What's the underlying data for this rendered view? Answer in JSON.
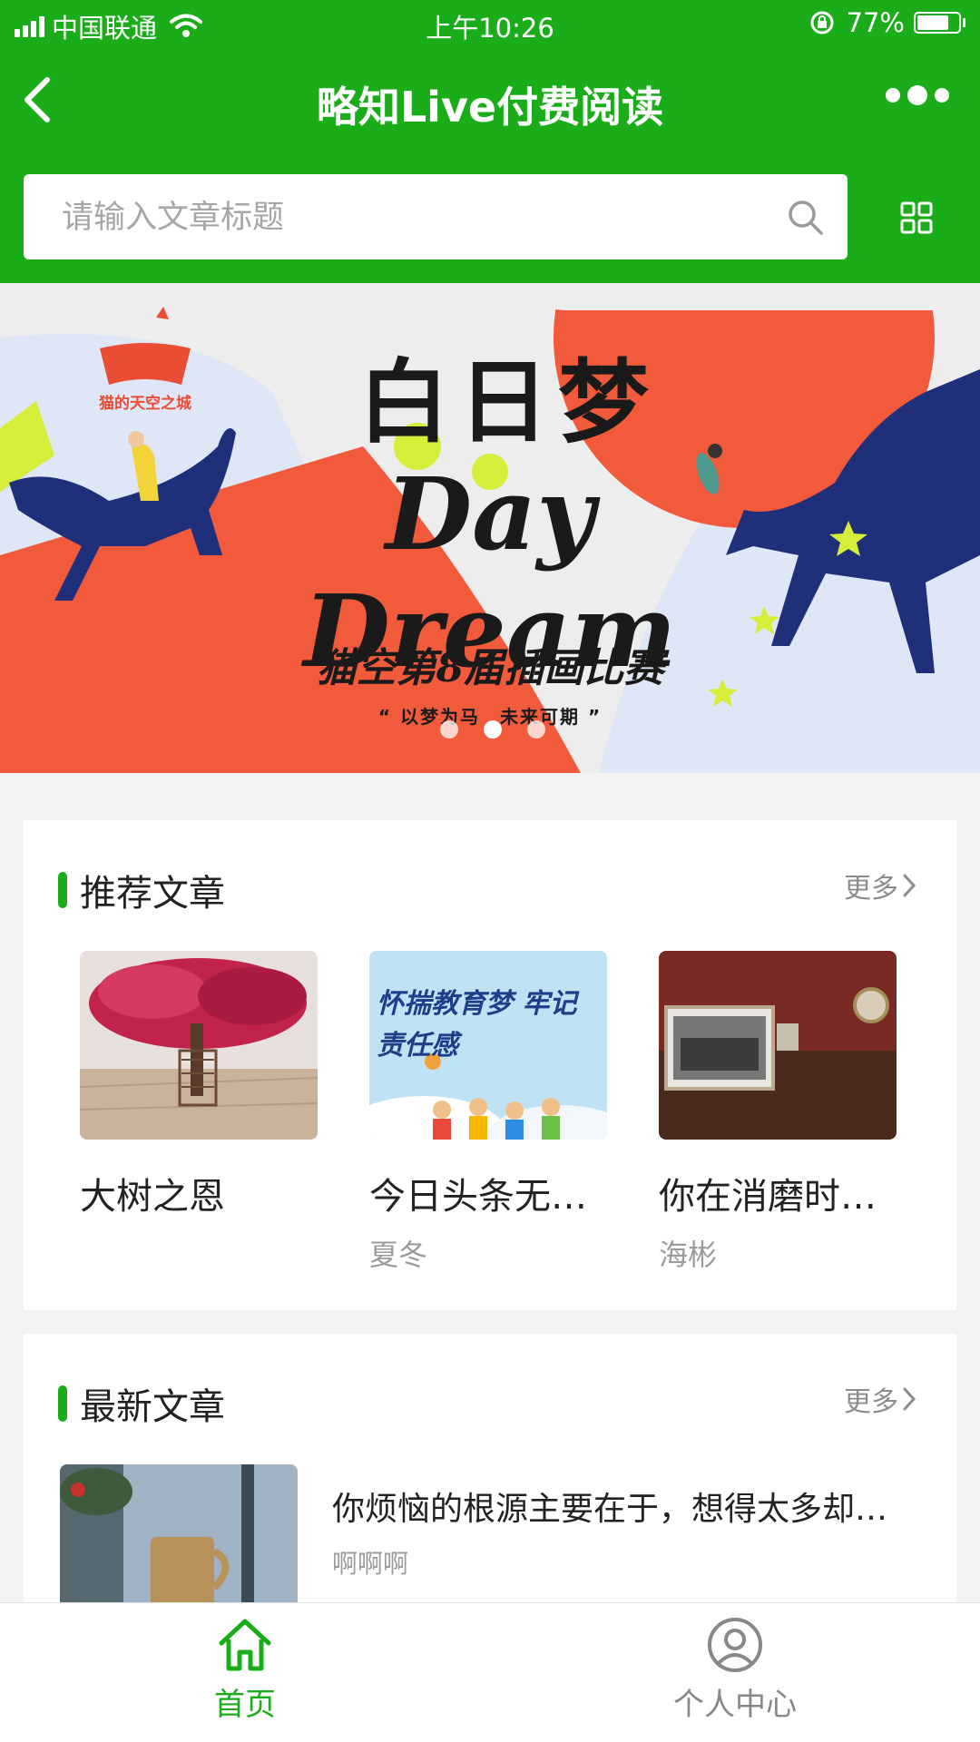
{
  "status_bar": {
    "carrier": "中国联通",
    "time": "上午10:26",
    "battery": "77%",
    "battery_level": 0.77
  },
  "nav": {
    "title": "略知Live付费阅读"
  },
  "search": {
    "placeholder": "请输入文章标题"
  },
  "banner": {
    "logo_text": "猫的天空之城",
    "title": "白日梦",
    "subtitle_en": "Day Dream",
    "contest": "猫空第8届插画比赛",
    "quote": "“ 以梦为马　未来可期 ”",
    "active_slide": 1,
    "slide_count": 3
  },
  "recommended": {
    "title": "推荐文章",
    "more": "更多",
    "items": [
      {
        "title": "大树之恩",
        "author": ""
      },
      {
        "title": "今日头条无…",
        "author": "夏冬",
        "thumb_text": "怀揣教育梦 牢记责任感"
      },
      {
        "title": "你在消磨时…",
        "author": "海彬"
      }
    ]
  },
  "latest": {
    "title": "最新文章",
    "more": "更多",
    "items": [
      {
        "title": "你烦恼的根源主要在于，想得太多却…",
        "author": "啊啊啊"
      }
    ]
  },
  "tabbar": {
    "home": "首页",
    "profile": "个人中心"
  },
  "colors": {
    "brand_green": "#1aad19",
    "banner_red": "#f15a3a",
    "banner_navy": "#1f2f7a"
  }
}
